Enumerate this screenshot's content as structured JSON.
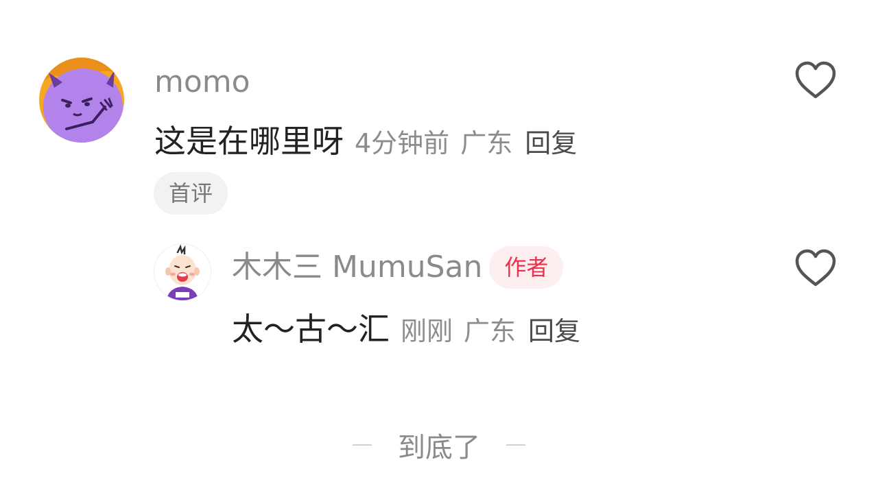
{
  "comments": [
    {
      "username": "momo",
      "content": "这是在哪里呀",
      "time": "4分钟前",
      "location": "广东",
      "reply_label": "回复",
      "tag": "首评",
      "avatar_icon": "purple-devil-avatar",
      "like_icon": "heart-outline-icon"
    }
  ],
  "reply": {
    "username": "木木三 MumuSan",
    "badge": "作者",
    "content": "太～古～汇",
    "time": "刚刚",
    "location": "广东",
    "reply_label": "回复",
    "avatar_icon": "cartoon-boy-avatar",
    "like_icon": "heart-outline-icon"
  },
  "footer": {
    "end_text": "到底了"
  },
  "colors": {
    "badge_text": "#f0304a",
    "badge_bg": "#fdeef0",
    "tag_bg": "#f2f2f2"
  }
}
